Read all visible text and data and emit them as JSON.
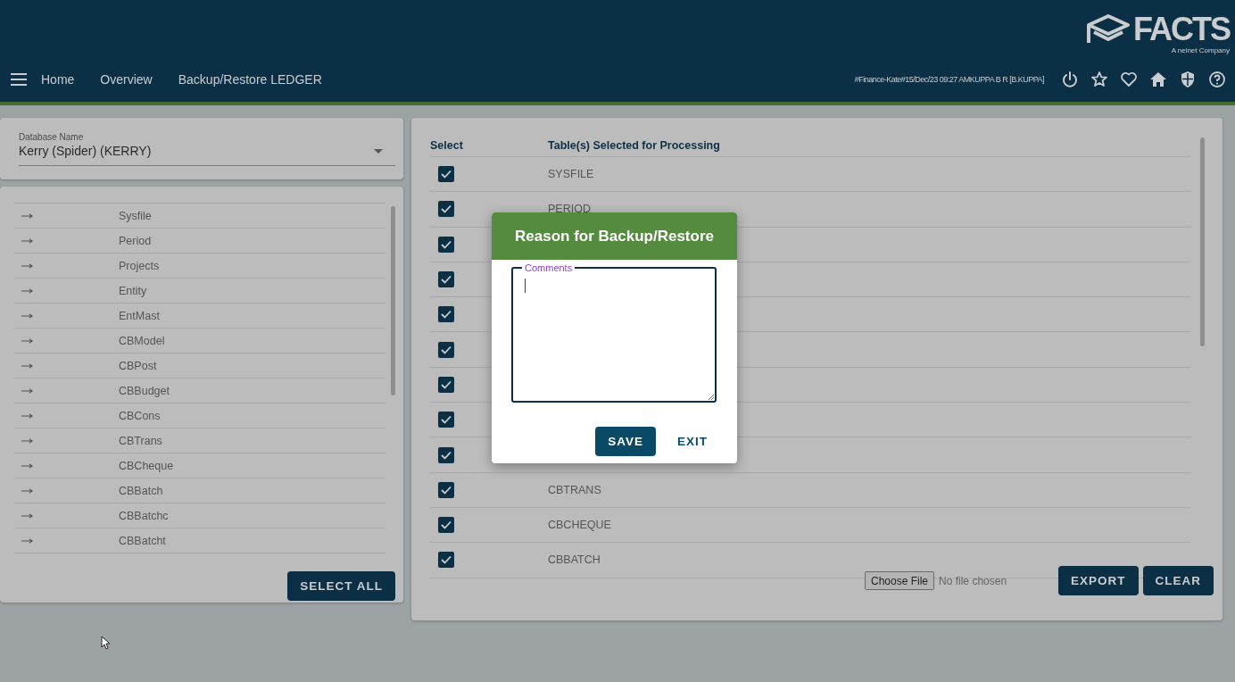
{
  "header": {
    "logo": {
      "name": "FACTS",
      "tagline": "A nelnet Company"
    },
    "nav": [
      "Home",
      "Overview",
      "Backup/Restore LEDGER"
    ],
    "session": "#Finance-Kate#15/Dec/23 09:27 AMKUPPA B R [B.KUPPA]"
  },
  "database": {
    "label": "Database Name",
    "value": "Kerry (Spider) (KERRY)"
  },
  "available_tables": [
    "Sysfile",
    "Period",
    "Projects",
    "Entity",
    "EntMast",
    "CBModel",
    "CBPost",
    "CBBudget",
    "CBCons",
    "CBTrans",
    "CBCheque",
    "CBBatch",
    "CBBatchc",
    "CBBatcht"
  ],
  "select_all_button": "SELECT ALL",
  "selected_table": {
    "columns": [
      "Select",
      "Table(s) Selected for Processing"
    ],
    "rows": [
      {
        "checked": true,
        "table": "SYSFILE"
      },
      {
        "checked": true,
        "table": "PERIOD"
      },
      {
        "checked": true
      },
      {
        "checked": true
      },
      {
        "checked": true
      },
      {
        "checked": true
      },
      {
        "checked": true
      },
      {
        "checked": true
      },
      {
        "checked": true
      },
      {
        "checked": true,
        "table": "CBTRANS"
      },
      {
        "checked": true,
        "table": "CBCHEQUE"
      },
      {
        "checked": true,
        "table": "CBBATCH"
      }
    ]
  },
  "file_input": {
    "button": "Choose File",
    "status": "No file chosen"
  },
  "buttons": [
    "EXPORT",
    "CLEAR"
  ],
  "dialog": {
    "title": "Reason for Backup/Restore",
    "comments_label": "Comments",
    "buttons": [
      "SAVE",
      "EXIT"
    ]
  }
}
